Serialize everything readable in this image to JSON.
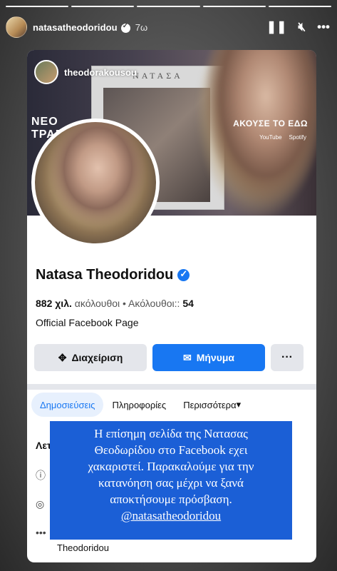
{
  "story": {
    "username": "natasatheodoridou",
    "time": "7ω",
    "icons": [
      "pause-icon",
      "mute-icon",
      "more-icon"
    ]
  },
  "facebook": {
    "cover": {
      "user": "theodorakousou",
      "album_title": "ΝΑΤΑΣΑ",
      "left_text": "ΝΕΟ\nΤΡΑΓ",
      "right_text": "ΑΚΟΥΣΕ ΤΟ ΕΔΩ",
      "brands": [
        "YouTube",
        "Spotify"
      ]
    },
    "page_name": "Natasa Theodoridou",
    "followers_value": "882 χιλ.",
    "followers_label": "ακόλουθοι",
    "following_label": "Ακόλουθοι::",
    "following_value": "54",
    "official": "Official Facebook Page",
    "buttons": {
      "manage": "Διαχείριση",
      "message": "Μήνυμα",
      "more": "···"
    },
    "tabs": {
      "posts": "Δημοσιεύσεις",
      "info": "Πληροφορίες",
      "more": "Περισσότερα"
    },
    "partial_heading": "Λετ",
    "bottom_text": "Theodoridou"
  },
  "overlay": {
    "line1": "Η επίσημη σελίδα της Νατασας",
    "line2": "Θεοδωρίδου στο Facebook εχει",
    "line3": "χακαριστεί. Παρακαλούμε για την",
    "line4": "κατανόηση σας μέχρι να ξανά",
    "line5": "αποκτήσουμε πρόσβαση.",
    "handle": "@natasatheodoridou"
  }
}
